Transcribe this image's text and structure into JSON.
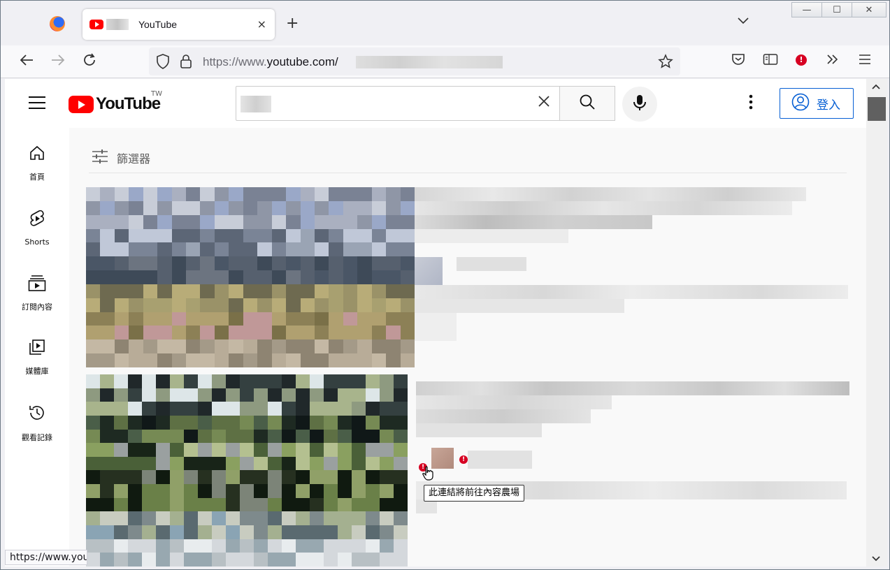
{
  "browser": {
    "tab_title": "YouTube",
    "tab_close": "×",
    "new_tab": "+",
    "list_tabs": "⌄",
    "url_prefix": "https://www.",
    "url_domain": "youtube.com/",
    "window_controls": [
      "—",
      "☐",
      "✕"
    ],
    "status_url": "https://www.you"
  },
  "youtube": {
    "logo_text": "YouTube",
    "region": "TW",
    "signin_label": "登入",
    "filter_label": "篩選器",
    "sidebar": [
      {
        "label": "首頁",
        "icon": "home-icon"
      },
      {
        "label": "Shorts",
        "icon": "shorts-icon"
      },
      {
        "label": "訂閱內容",
        "icon": "subscriptions-icon"
      },
      {
        "label": "媒體庫",
        "icon": "library-icon"
      },
      {
        "label": "觀看記錄",
        "icon": "history-icon"
      }
    ],
    "tooltip": "此連結將前往內容農場"
  },
  "colors": {
    "yt_red": "#ff0000",
    "link_blue": "#065fd4",
    "warning_red": "#d70022"
  }
}
